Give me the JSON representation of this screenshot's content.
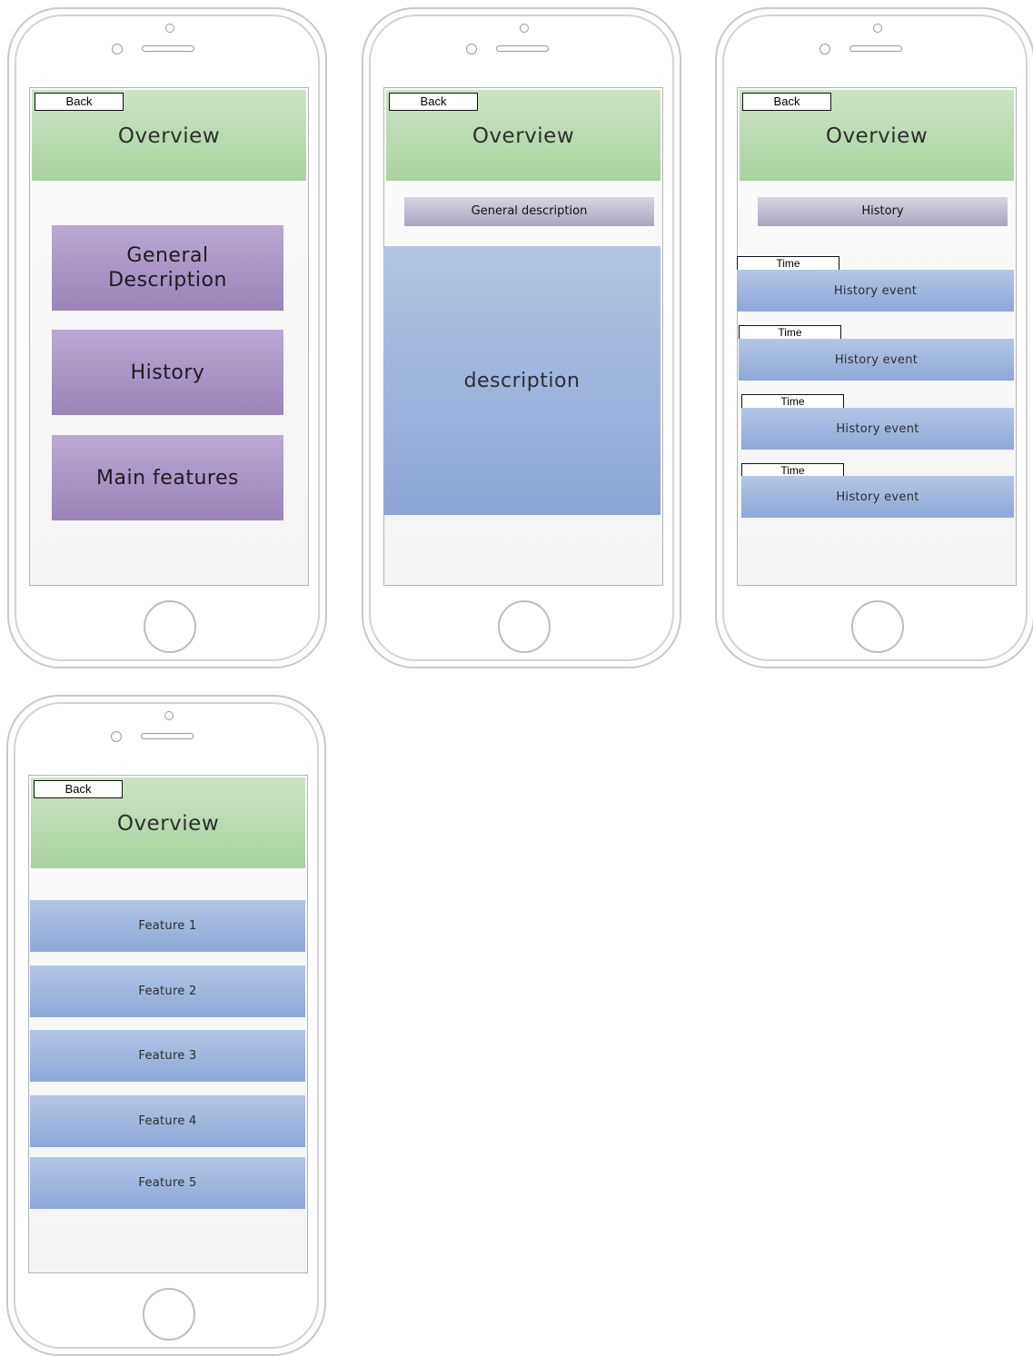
{
  "screens": {
    "menu": {
      "back_label": "Back",
      "title": "Overview",
      "buttons": [
        "General\nDescription",
        "History",
        "Main features"
      ]
    },
    "general": {
      "back_label": "Back",
      "title": "Overview",
      "section_label": "General description",
      "body_text": "description"
    },
    "history": {
      "back_label": "Back",
      "title": "Overview",
      "section_label": "History",
      "events": [
        {
          "time": "Time",
          "label": "History event"
        },
        {
          "time": "Time",
          "label": "History event"
        },
        {
          "time": "Time",
          "label": "History event"
        },
        {
          "time": "Time",
          "label": "History event"
        }
      ]
    },
    "features": {
      "back_label": "Back",
      "title": "Overview",
      "items": [
        "Feature 1",
        "Feature 2",
        "Feature 3",
        "Feature 4",
        "Feature 5"
      ]
    }
  }
}
